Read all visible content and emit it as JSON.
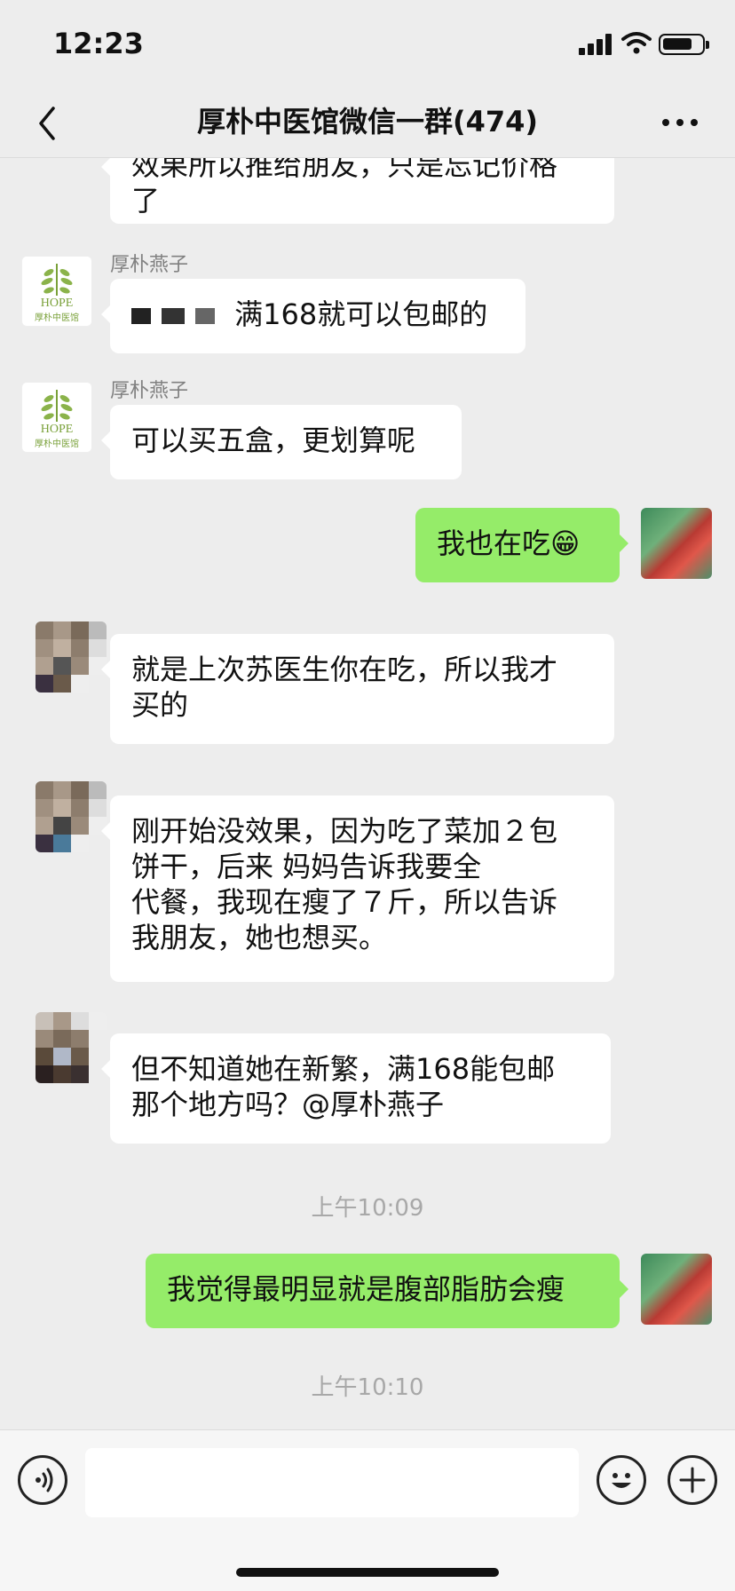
{
  "status_bar": {
    "time": "12:23"
  },
  "nav": {
    "title": "厚朴中医馆微信一群(474)"
  },
  "messages": [
    {
      "id": "m0",
      "side": "left",
      "text_lines": [
        "效果所以推给朋友，只是忘记价格",
        "了"
      ]
    },
    {
      "id": "m1",
      "side": "left",
      "sender": "厚朴燕子",
      "text": "满168就可以包邮的"
    },
    {
      "id": "m2",
      "side": "left",
      "sender": "厚朴燕子",
      "text": "可以买五盒，更划算呢"
    },
    {
      "id": "m3",
      "side": "right",
      "text": "我也在吃😁"
    },
    {
      "id": "m4",
      "side": "left",
      "text_lines": [
        "就是上次苏医生你在吃，所以我才",
        "买的"
      ]
    },
    {
      "id": "m5",
      "side": "left",
      "text_lines": [
        "刚开始没效果，因为吃了菜加２包",
        "饼干，后来         妈妈告诉我要全",
        "代餐，我现在瘦了７斤，所以告诉",
        "我朋友，她也想买。"
      ]
    },
    {
      "id": "m6",
      "side": "left",
      "text_lines": [
        "但不知道她在新繁，满168能包邮",
        "那个地方吗？@厚朴燕子"
      ]
    },
    {
      "id": "m7",
      "side": "right",
      "text": "我觉得最明显就是腹部脂肪会瘦"
    }
  ],
  "timestamps": {
    "t1": "上午10:09",
    "t2": "上午10:10"
  },
  "avatar_text": {
    "hope_logo": "HOPE",
    "hope_name": "厚朴中医馆"
  },
  "input": {
    "placeholder": ""
  },
  "colors": {
    "bubble_mine": "#95ec69",
    "bubble_other": "#ffffff",
    "background": "#ededed"
  }
}
